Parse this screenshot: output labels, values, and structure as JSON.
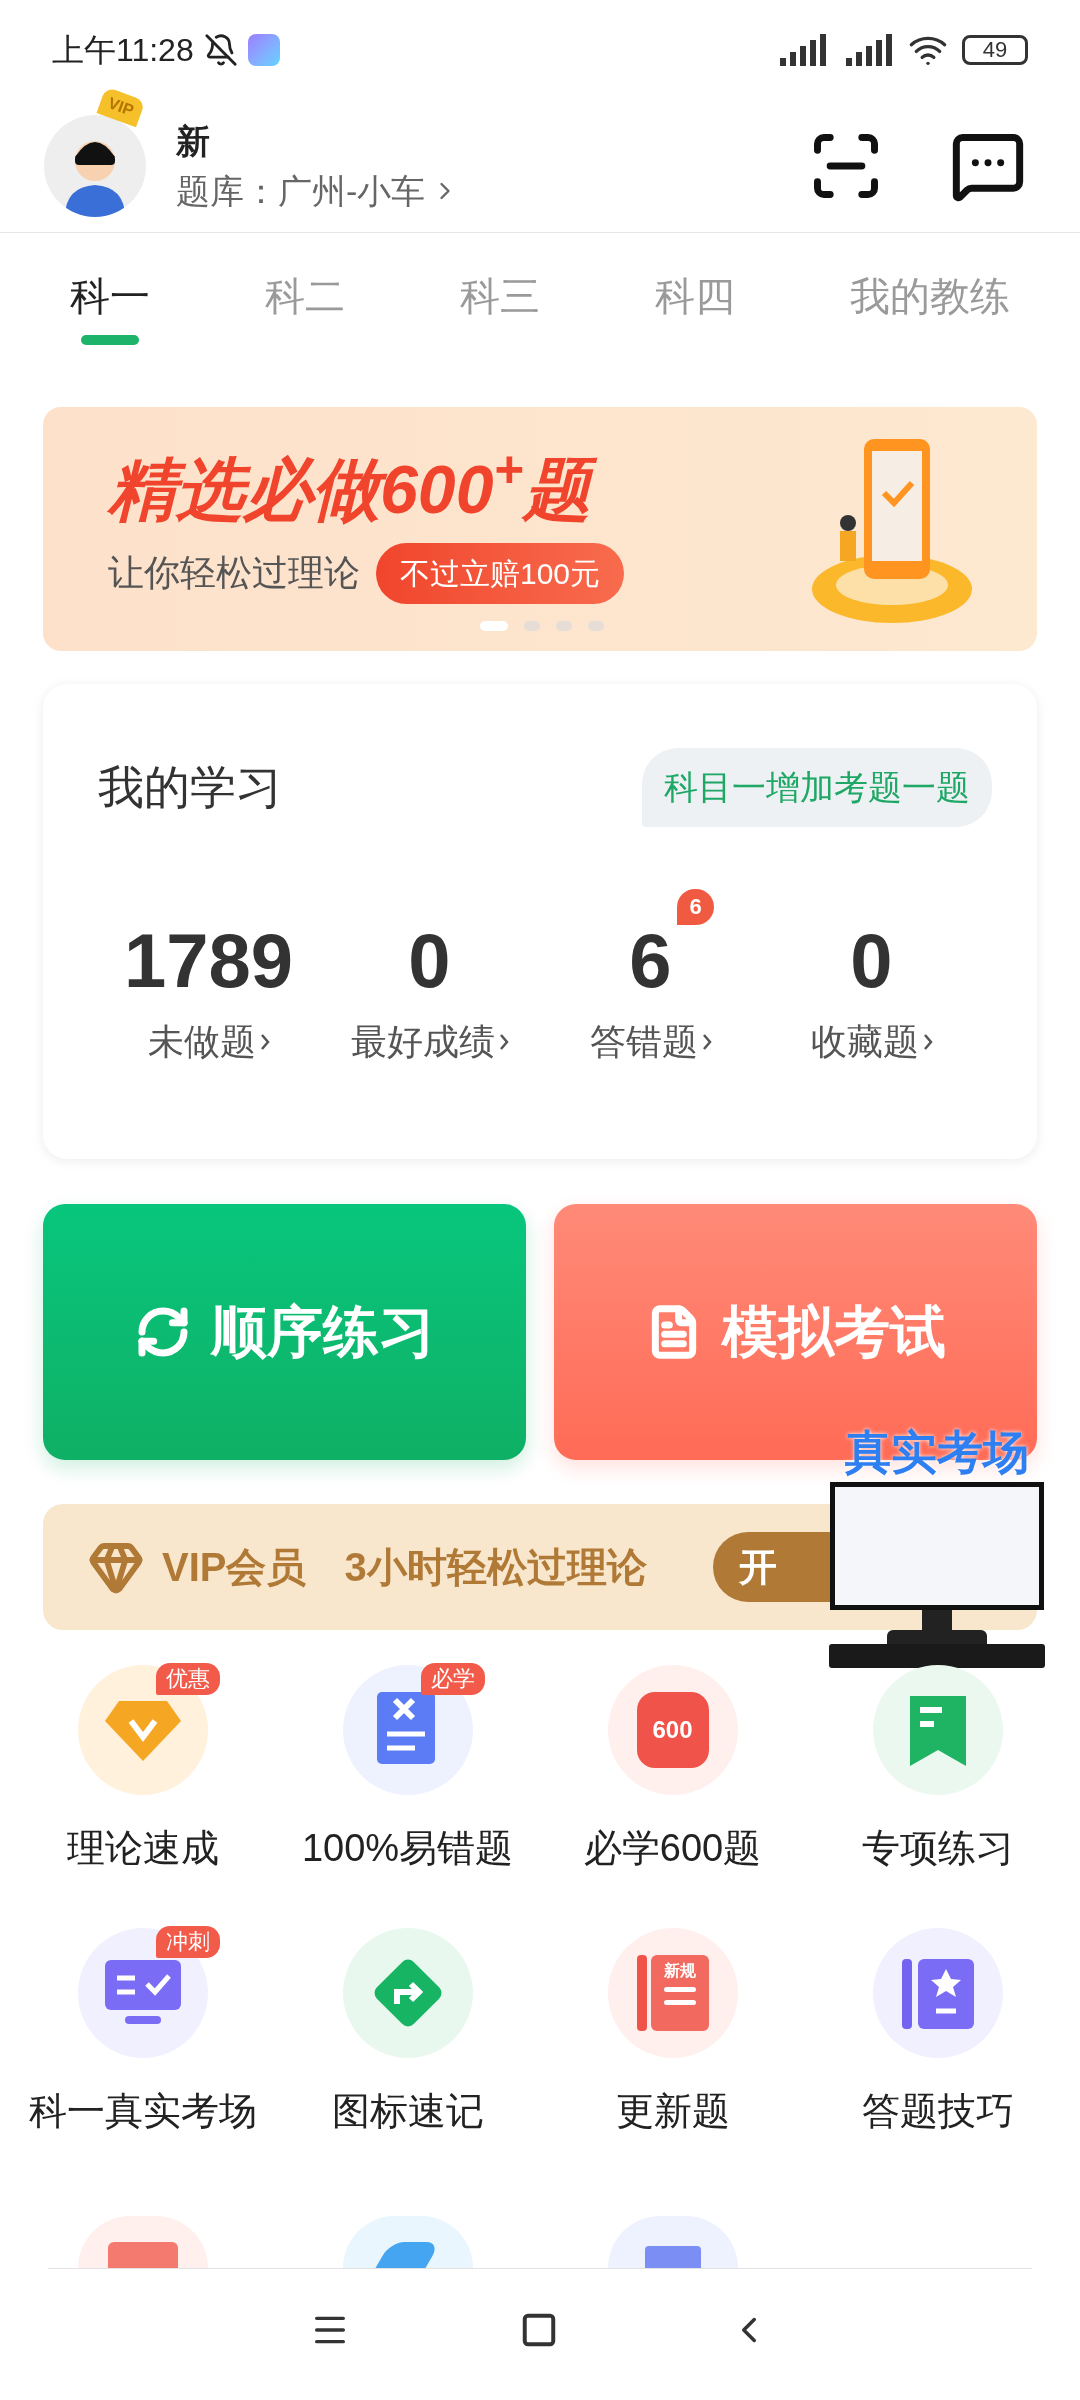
{
  "status_bar": {
    "time": "上午11:28",
    "battery": "49"
  },
  "profile": {
    "crown": "VIP",
    "name": "新",
    "question_bank": "题库：广州-小车"
  },
  "tabs": [
    {
      "label": "科一",
      "selected": true
    },
    {
      "label": "科二",
      "selected": false
    },
    {
      "label": "科三",
      "selected": false
    },
    {
      "label": "科四",
      "selected": false
    },
    {
      "label": "我的教练",
      "selected": false
    }
  ],
  "banner": {
    "title": "精选必做600$^{+}$题",
    "subtitle": "让你轻松过理论",
    "badge": "不过立赔100元",
    "dots": [
      {
        "selected": true
      },
      {
        "selected": false
      },
      {
        "selected": false
      },
      {
        "selected": false
      }
    ]
  },
  "study": {
    "title": "我的学习",
    "notice": "科目一增加考题一题",
    "stats": [
      {
        "value": "1789",
        "label": "未做题"
      },
      {
        "value": "0",
        "label": "最好成绩"
      },
      {
        "value": "6",
        "label": "答错题",
        "badge": "6"
      },
      {
        "value": "0",
        "label": "收藏题"
      }
    ]
  },
  "actions": [
    {
      "kind": "sequence",
      "label": "顺序练习"
    },
    {
      "kind": "exam",
      "label": "模拟考试"
    }
  ],
  "vip": {
    "label": "VIP会员",
    "text": "3小时轻松过理论",
    "button": "开"
  },
  "overlay": {
    "title": "真实考场"
  },
  "features": [
    {
      "kind": "diamond",
      "label": "理论速成",
      "tag": "优惠"
    },
    {
      "kind": "wrong",
      "label": "100%易错题",
      "tag": "必学"
    },
    {
      "kind": "weight",
      "label": "必学600题",
      "icon_text": "600"
    },
    {
      "kind": "bookmark",
      "label": "专项练习"
    },
    {
      "kind": "monitor",
      "label": "科一真实考场",
      "tag": "冲刺"
    },
    {
      "kind": "sign",
      "label": "图标速记"
    },
    {
      "kind": "newrule",
      "label": "更新题",
      "icon_text": "新规"
    },
    {
      "kind": "tips",
      "label": "答题技巧"
    }
  ],
  "partial_features": [
    {
      "kind": "video"
    },
    {
      "kind": "eraser"
    },
    {
      "kind": "score"
    }
  ]
}
